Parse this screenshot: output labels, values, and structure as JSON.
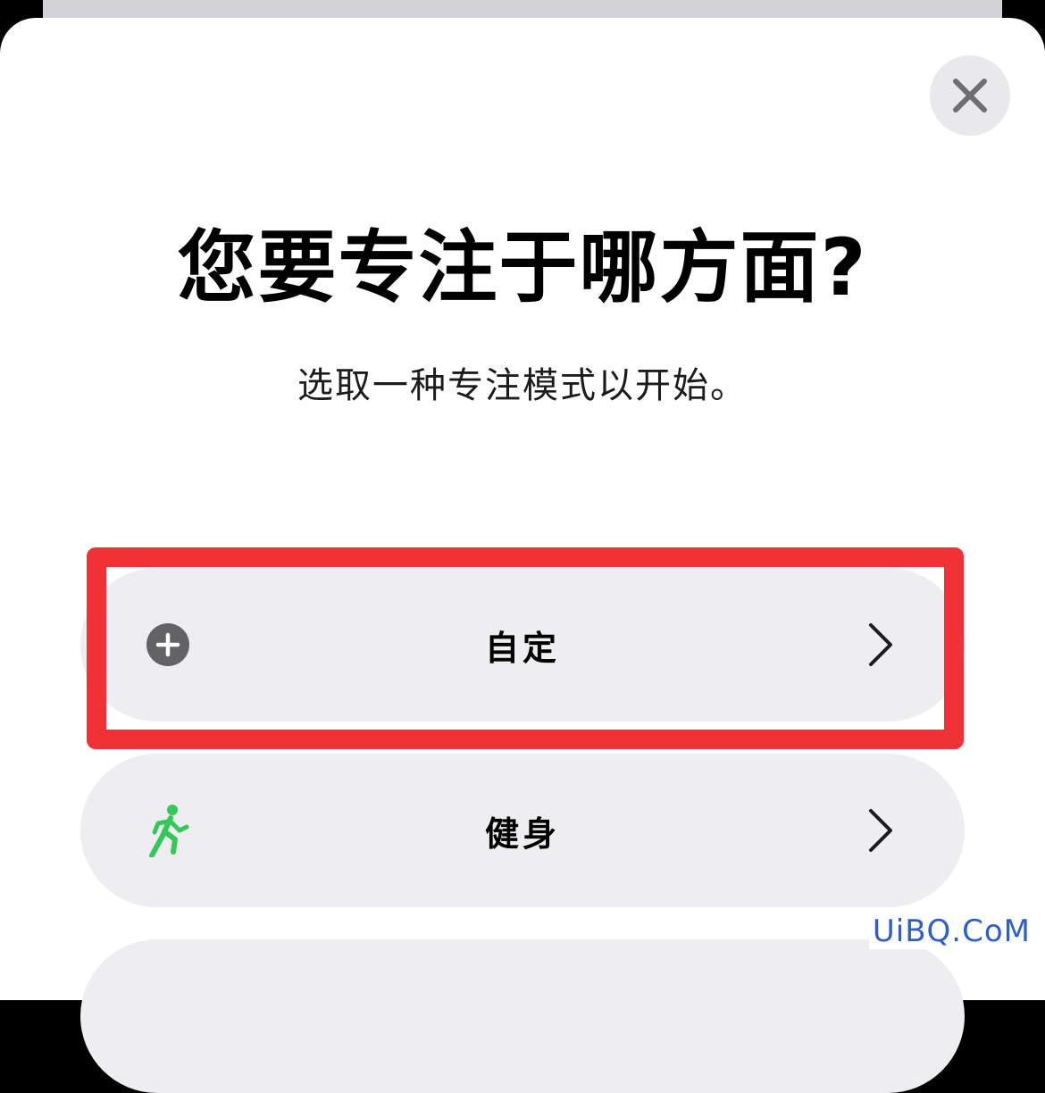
{
  "header": {
    "title": "您要专注于哪方面?",
    "subtitle": "选取一种专注模式以开始。"
  },
  "options": [
    {
      "label": "自定",
      "icon": "plus-circle-icon"
    },
    {
      "label": "健身",
      "icon": "running-person-icon"
    },
    {
      "label": ""
    }
  ],
  "colors": {
    "accent_highlight": "#f03237",
    "fitness_icon": "#34c759",
    "option_background": "#eeeef0",
    "close_background": "#e9e9eb"
  },
  "watermark": "UiBQ.CoM"
}
